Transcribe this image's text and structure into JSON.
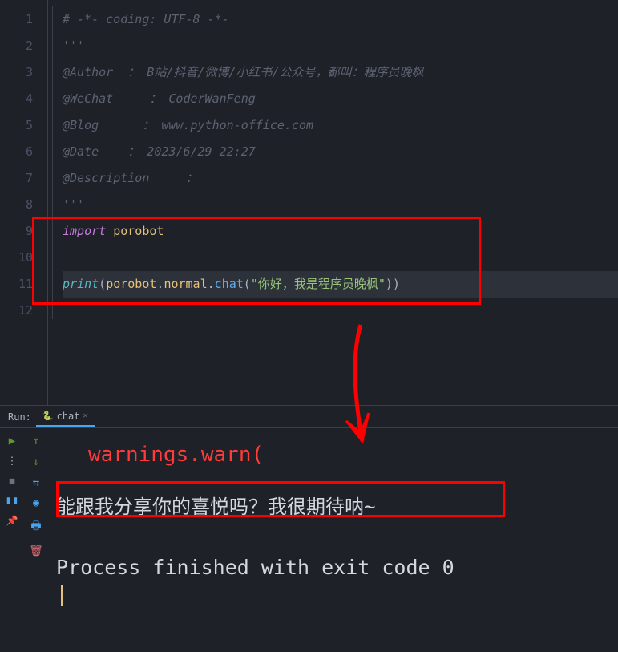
{
  "editor": {
    "lines": [
      {
        "n": 1,
        "seg": [
          {
            "c": "c-comment",
            "t": "# -*- coding: UTF-8 -*-"
          }
        ]
      },
      {
        "n": 2,
        "seg": [
          {
            "c": "c-comment",
            "t": "'''"
          }
        ]
      },
      {
        "n": 3,
        "seg": [
          {
            "c": "c-comment",
            "t": "@Author  ： B站/抖音/微博/小红书/公众号，都叫：程序员晚枫"
          }
        ]
      },
      {
        "n": 4,
        "seg": [
          {
            "c": "c-comment",
            "t": "@WeChat     ： CoderWanFeng"
          }
        ]
      },
      {
        "n": 5,
        "seg": [
          {
            "c": "c-comment",
            "t": "@Blog      ： www.python-office.com"
          }
        ]
      },
      {
        "n": 6,
        "seg": [
          {
            "c": "c-comment",
            "t": "@Date    ： 2023/6/29 22:27"
          }
        ]
      },
      {
        "n": 7,
        "seg": [
          {
            "c": "c-comment",
            "t": "@Description     ："
          }
        ]
      },
      {
        "n": 8,
        "seg": [
          {
            "c": "c-comment",
            "t": "'''"
          }
        ]
      },
      {
        "n": 9,
        "seg": [
          {
            "c": "c-keyword",
            "t": "import "
          },
          {
            "c": "c-module",
            "t": "porobot"
          }
        ]
      },
      {
        "n": 10,
        "seg": []
      },
      {
        "n": 11,
        "hl": true,
        "seg": [
          {
            "c": "c-func",
            "t": "print"
          },
          {
            "c": "c-punct",
            "t": "("
          },
          {
            "c": "c-module",
            "t": "porobot"
          },
          {
            "c": "c-punct",
            "t": "."
          },
          {
            "c": "c-module",
            "t": "normal"
          },
          {
            "c": "c-punct",
            "t": "."
          },
          {
            "c": "c-call",
            "t": "chat"
          },
          {
            "c": "c-punct",
            "t": "("
          },
          {
            "c": "c-string",
            "t": "\"你好，我是程序员晚枫\""
          },
          {
            "c": "c-punct",
            "t": "))"
          }
        ]
      },
      {
        "n": 12,
        "seg": []
      }
    ]
  },
  "run": {
    "label": "Run:",
    "tab": {
      "name": "chat",
      "icon": "🐍"
    },
    "toolbar_left": [
      "play",
      "dots",
      "stop",
      "bars",
      "pin"
    ],
    "toolbar_right": [
      "restart",
      "down",
      "wrap",
      "circle",
      "print",
      "trash"
    ],
    "output": {
      "warn": "warnings.warn(",
      "response": "能跟我分享你的喜悦吗？我很期待呐~",
      "exit": "Process finished with exit code 0"
    }
  }
}
